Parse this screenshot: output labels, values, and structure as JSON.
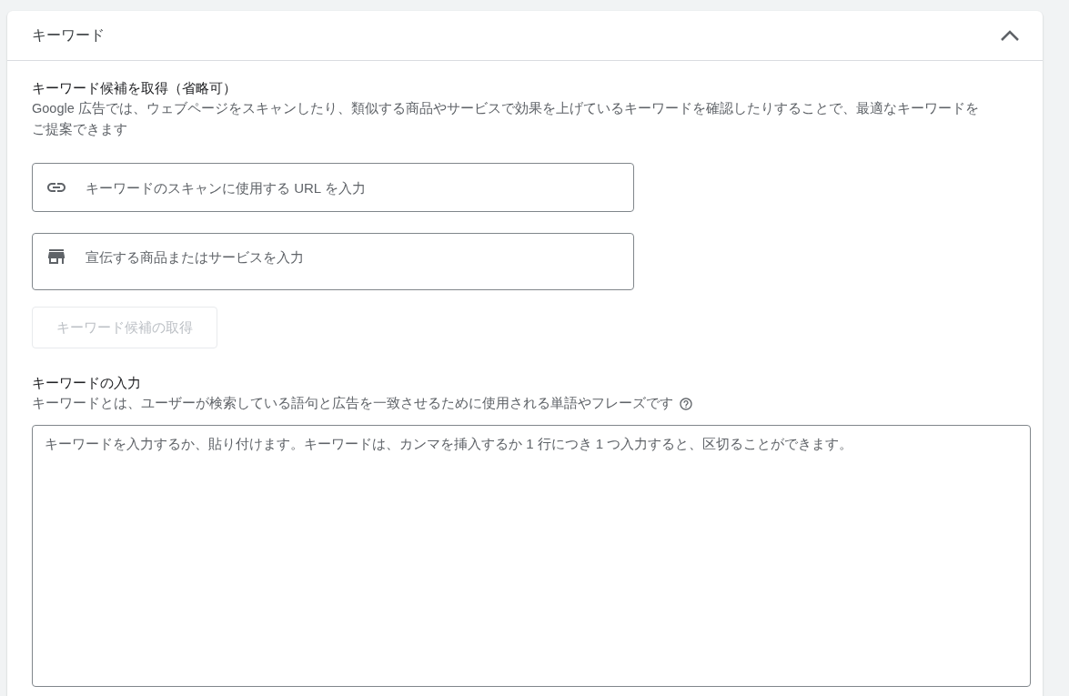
{
  "panel": {
    "title": "キーワード",
    "expanded": true
  },
  "suggestions": {
    "title": "キーワード候補を取得（省略可）",
    "description": "Google 広告では、ウェブページをスキャンしたり、類似する商品やサービスで効果を上げているキーワードを確認したりすることで、最適なキーワードをご提案できます",
    "fields": [
      {
        "kind": "link",
        "placeholder": "キーワードのスキャンに使用する URL を入力"
      },
      {
        "kind": "store",
        "placeholder": "宣伝する商品またはサービスを入力"
      }
    ],
    "button": {
      "label": "キーワード候補の取得",
      "disabled": true
    }
  },
  "keywords": {
    "title": "キーワードの入力",
    "description": "キーワードとは、ユーザーが検索している語句と広告を一致させるために使用される単語やフレーズです",
    "placeholder": "キーワードを入力するか、貼り付けます。キーワードは、カンマを挿入するか 1 行につき 1 つ入力すると、区切ることができます。"
  }
}
